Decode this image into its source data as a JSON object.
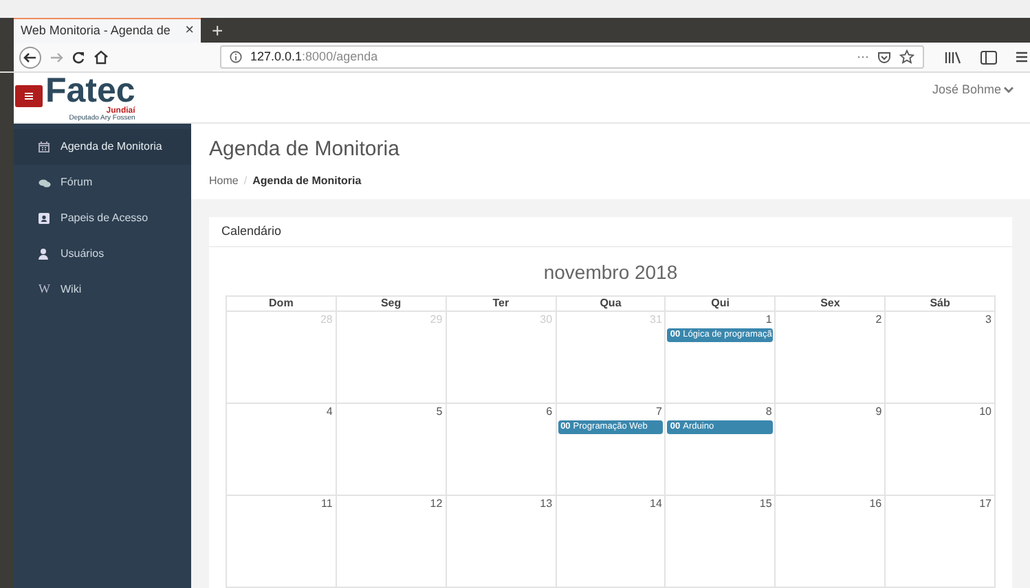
{
  "browser": {
    "tab_title": "Web Monitoria - Agenda de",
    "close": "×",
    "new_tab": "+",
    "url_host": "127.0.0.1",
    "url_rest": ":8000/agenda",
    "page_actions": "···"
  },
  "header": {
    "logo": "Fatec",
    "logo_city": "Jundiaí",
    "logo_subtitle": "Deputado Ary Fossen",
    "user": "José Bohme"
  },
  "sidebar": {
    "items": [
      {
        "label": "Agenda de Monitoria",
        "selected": true
      },
      {
        "label": "Fórum",
        "selected": false
      },
      {
        "label": "Papeis de Acesso",
        "selected": false
      },
      {
        "label": "Usuários",
        "selected": false
      },
      {
        "label": "Wiki",
        "icon_glyph": "W",
        "selected": false
      }
    ]
  },
  "page": {
    "title": "Agenda de Monitoria",
    "breadcrumb_separator": "/",
    "breadcrumb": [
      {
        "label": "Home",
        "current": false
      },
      {
        "label": "Agenda de Monitoria",
        "current": true
      }
    ]
  },
  "calendar": {
    "card_title": "Calendário",
    "month": "novembro 2018",
    "weekdays": [
      "Dom",
      "Seg",
      "Ter",
      "Qua",
      "Qui",
      "Sex",
      "Sáb"
    ],
    "weeks": [
      [
        {
          "day": "28",
          "other_month": true
        },
        {
          "day": "29",
          "other_month": true
        },
        {
          "day": "30",
          "other_month": true
        },
        {
          "day": "31",
          "other_month": true
        },
        {
          "day": "1",
          "other_month": false,
          "events": [
            {
              "time": "00",
              "title": "Lógica de programaçã"
            }
          ]
        },
        {
          "day": "2",
          "other_month": false
        },
        {
          "day": "3",
          "other_month": false
        }
      ],
      [
        {
          "day": "4",
          "other_month": false
        },
        {
          "day": "5",
          "other_month": false
        },
        {
          "day": "6",
          "other_month": false
        },
        {
          "day": "7",
          "other_month": false,
          "events": [
            {
              "time": "00",
              "title": "Programação Web"
            }
          ]
        },
        {
          "day": "8",
          "other_month": false,
          "events": [
            {
              "time": "00",
              "title": "Arduino"
            }
          ]
        },
        {
          "day": "9",
          "other_month": false
        },
        {
          "day": "10",
          "other_month": false
        }
      ],
      [
        {
          "day": "11",
          "other_month": false
        },
        {
          "day": "12",
          "other_month": false
        },
        {
          "day": "13",
          "other_month": false
        },
        {
          "day": "14",
          "other_month": false
        },
        {
          "day": "15",
          "other_month": false
        },
        {
          "day": "16",
          "other_month": false
        },
        {
          "day": "17",
          "other_month": false
        }
      ]
    ]
  }
}
